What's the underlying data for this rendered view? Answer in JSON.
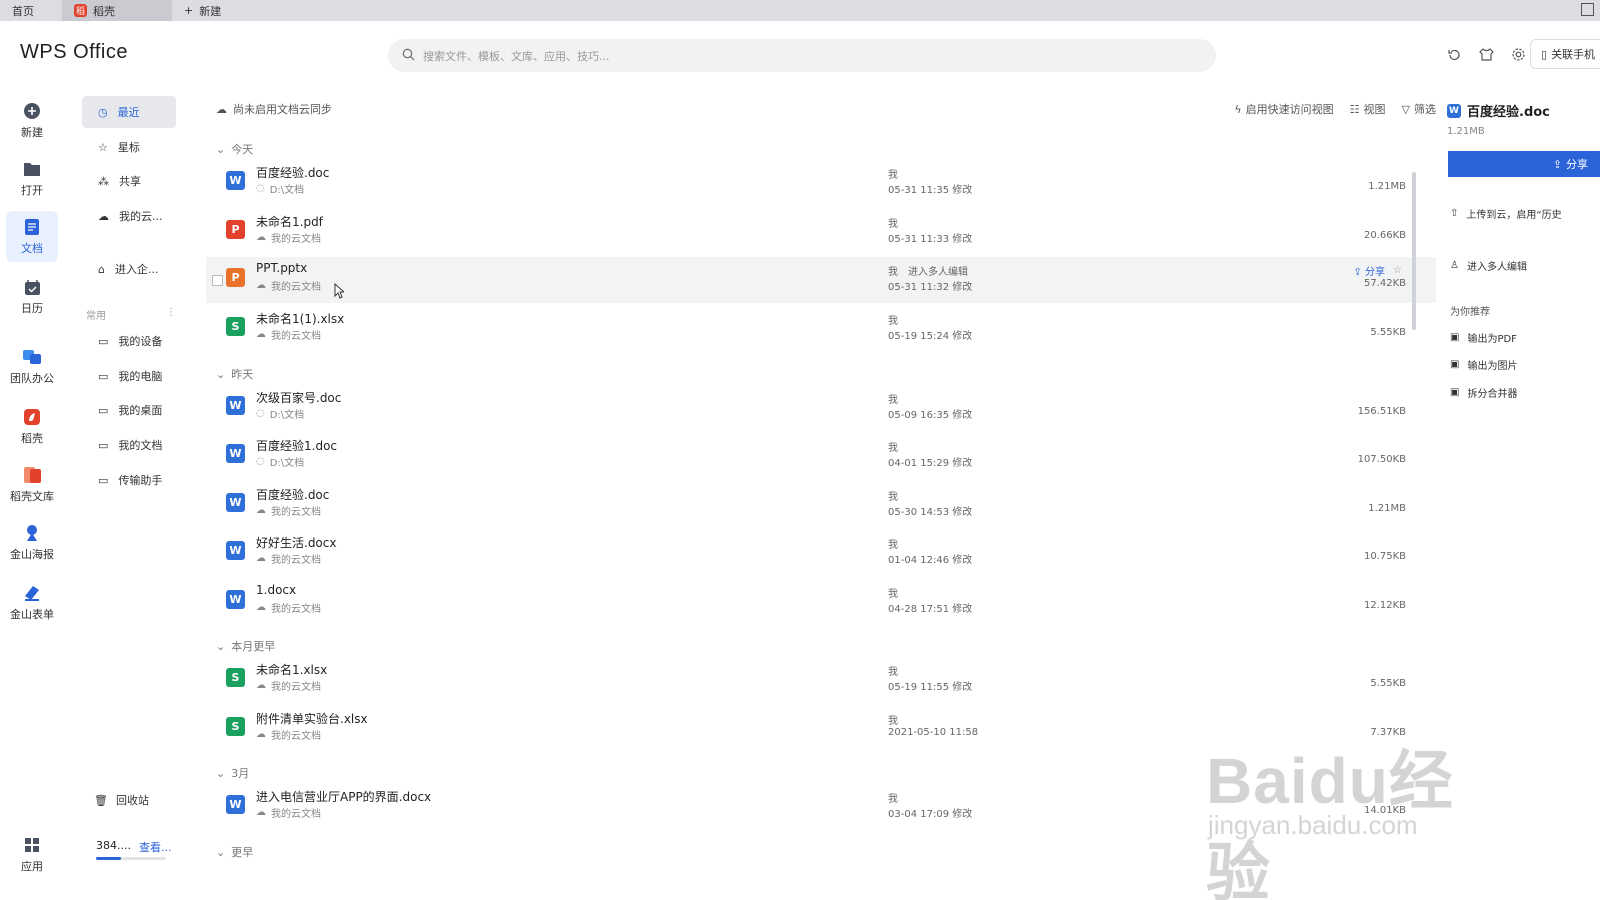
{
  "tabs": {
    "home": "首页",
    "doke": "稻壳",
    "new": "新建"
  },
  "app": {
    "logo": "WPS Office"
  },
  "search": {
    "placeholder": "搜索文件、模板、文库、应用、技巧..."
  },
  "header": {
    "phone_button": "关联手机"
  },
  "rail": {
    "items": [
      {
        "label": "新建",
        "icon": "plus-circle-icon"
      },
      {
        "label": "打开",
        "icon": "folder-icon"
      },
      {
        "label": "文档",
        "icon": "document-icon"
      },
      {
        "label": "日历",
        "icon": "calendar-icon"
      },
      {
        "label": "团队办公",
        "icon": "team-icon"
      },
      {
        "label": "稻壳",
        "icon": "doke-icon"
      },
      {
        "label": "稻壳文库",
        "icon": "library-icon"
      },
      {
        "label": "金山海报",
        "icon": "poster-icon"
      },
      {
        "label": "金山表单",
        "icon": "form-icon"
      },
      {
        "label": "应用",
        "icon": "apps-grid-icon"
      }
    ]
  },
  "sidebar": {
    "items": [
      {
        "label": "最近",
        "icon": "clock-icon"
      },
      {
        "label": "星标",
        "icon": "star-icon"
      },
      {
        "label": "共享",
        "icon": "share-icon"
      },
      {
        "label": "我的云...",
        "icon": "cloud-icon"
      },
      {
        "label": "进入企...",
        "icon": "enterprise-icon"
      }
    ],
    "common_title": "常用",
    "common": [
      {
        "label": "我的设备"
      },
      {
        "label": "我的电脑"
      },
      {
        "label": "我的桌面"
      },
      {
        "label": "我的文档"
      },
      {
        "label": "传输助手"
      }
    ],
    "recycle": "回收站",
    "usage_text": "384....",
    "usage_link": "查看...",
    "usage_fraction": 0.35
  },
  "toolbar": {
    "cloud_sync": "尚未启用文档云同步",
    "quick_access": "启用快速访问视图",
    "view": "视图",
    "filter": "筛选"
  },
  "groups": [
    {
      "title": "今天"
    },
    {
      "title": "昨天"
    },
    {
      "title": "本月更早"
    },
    {
      "title": "3月"
    },
    {
      "title": "更早"
    }
  ],
  "files": [
    {
      "name": "百度经验.doc",
      "path": "D:\\文档",
      "owner": "我",
      "date": "05-31 11:35 修改",
      "size": "1.21MB",
      "type": "W"
    },
    {
      "name": "未命名1.pdf",
      "path": "我的云文档",
      "owner": "我",
      "date": "05-31 11:33 修改",
      "size": "20.66KB",
      "type": "P"
    },
    {
      "name": "PPT.pptx",
      "path": "我的云文档",
      "owner": "我",
      "extra": "进入多人编辑",
      "date": "05-31 11:32 修改",
      "size": "57.42KB",
      "type": "P",
      "share": "分享"
    },
    {
      "name": "未命名1(1).xlsx",
      "path": "我的云文档",
      "owner": "我",
      "date": "05-19 15:24 修改",
      "size": "5.55KB",
      "type": "S"
    },
    {
      "name": "次级百家号.doc",
      "path": "D:\\文档",
      "owner": "我",
      "date": "05-09 16:35 修改",
      "size": "156.51KB",
      "type": "W"
    },
    {
      "name": "百度经验1.doc",
      "path": "D:\\文档",
      "owner": "我",
      "date": "04-01 15:29 修改",
      "size": "107.50KB",
      "type": "W"
    },
    {
      "name": "百度经验.doc",
      "path": "我的云文档",
      "owner": "我",
      "date": "05-30 14:53 修改",
      "size": "1.21MB",
      "type": "W"
    },
    {
      "name": "好好生活.docx",
      "path": "我的云文档",
      "owner": "我",
      "date": "01-04 12:46 修改",
      "size": "10.75KB",
      "type": "W"
    },
    {
      "name": "1.docx",
      "path": "我的云文档",
      "owner": "我",
      "date": "04-28 17:51 修改",
      "size": "12.12KB",
      "type": "W"
    },
    {
      "name": "未命名1.xlsx",
      "path": "我的云文档",
      "owner": "我",
      "date": "05-19 11:55 修改",
      "size": "5.55KB",
      "type": "S"
    },
    {
      "name": "附件清单实验台.xlsx",
      "path": "我的云文档",
      "owner": "我",
      "date": "2021-05-10 11:58",
      "size": "7.37KB",
      "type": "S"
    },
    {
      "name": "进入电信营业厅APP的界面.docx",
      "path": "我的云文档",
      "owner": "我",
      "date": "03-04 17:09 修改",
      "size": "14.01KB",
      "type": "W"
    }
  ],
  "rpanel": {
    "title": "百度经验.doc",
    "size": "1.21MB",
    "share": "分享",
    "upload": "上传到云，启用“历史",
    "multi_edit": "进入多人编辑",
    "recommend": "为你推荐",
    "actions": [
      "输出为PDF",
      "输出为图片",
      "拆分合并器"
    ]
  },
  "watermark": {
    "main": "Baidu经验",
    "sub": "jingyan.baidu.com"
  }
}
